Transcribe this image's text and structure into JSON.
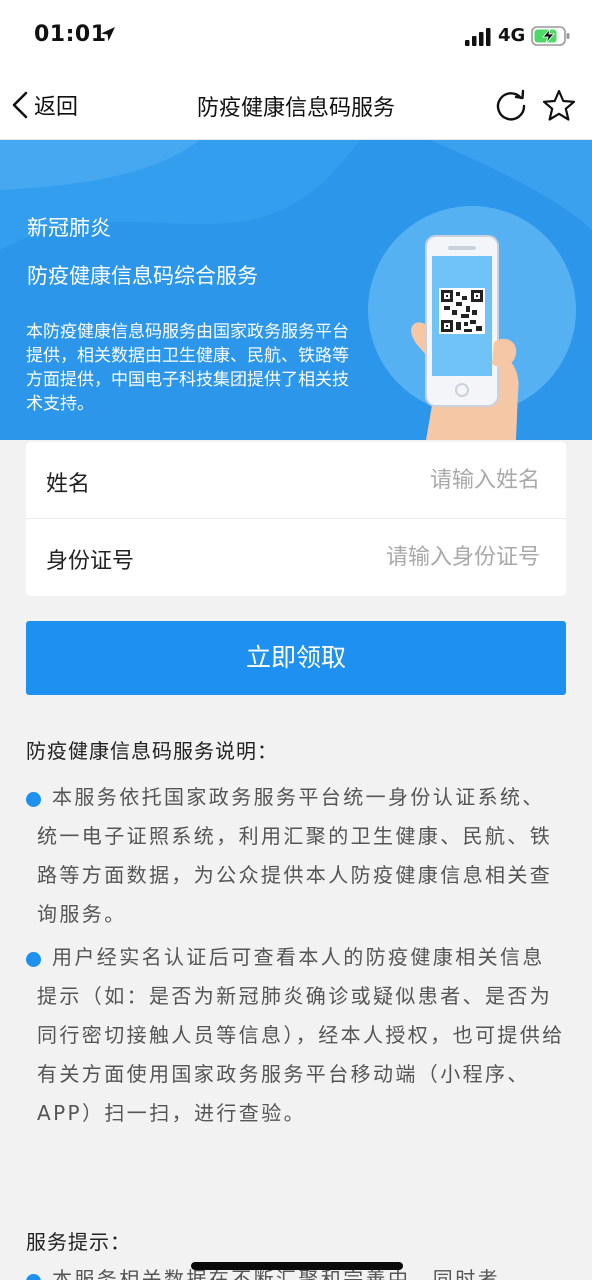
{
  "status_bar": {
    "time": "01:01",
    "network": "4G"
  },
  "nav": {
    "back_label": "返回",
    "title": "防疫健康信息码服务"
  },
  "banner": {
    "subtitle": "新冠肺炎",
    "title": "防疫健康信息码综合服务",
    "description": "本防疫健康信息码服务由国家政务服务平台提供，相关数据由卫生健康、民航、铁路等方面提供，中国电子科技集团提供了相关技术支持。"
  },
  "form": {
    "name_label": "姓名",
    "name_placeholder": "请输入姓名",
    "id_label": "身份证号",
    "id_placeholder": "请输入身份证号"
  },
  "submit_label": "立即领取",
  "description": {
    "heading": "防疫健康信息码服务说明：",
    "items": [
      "本服务依托国家政务服务平台统一身份认证系统、统一电子证照系统，利用汇聚的卫生健康、民航、铁路等方面数据，为公众提供本人防疫健康信息相关查询服务。",
      "用户经实名认证后可查看本人的防疫健康相关信息提示（如：是否为新冠肺炎确诊或疑似患者、是否为同行密切接触人员等信息），经本人授权，也可提供给有关方面使用国家政务服务平台移动端（小程序、APP）扫一扫，进行查验。"
    ]
  },
  "tips": {
    "heading": "服务提示：",
    "items": [
      "本服务相关数据在不断汇聚和完善中，同时考"
    ]
  },
  "colors": {
    "accent": "#1e90f0",
    "banner": "#2b96ea"
  },
  "icons": [
    "location-arrow-icon",
    "signal-icon",
    "battery-charging-icon",
    "back-chevron-icon",
    "refresh-icon",
    "star-icon",
    "phone-qr-illustration"
  ]
}
